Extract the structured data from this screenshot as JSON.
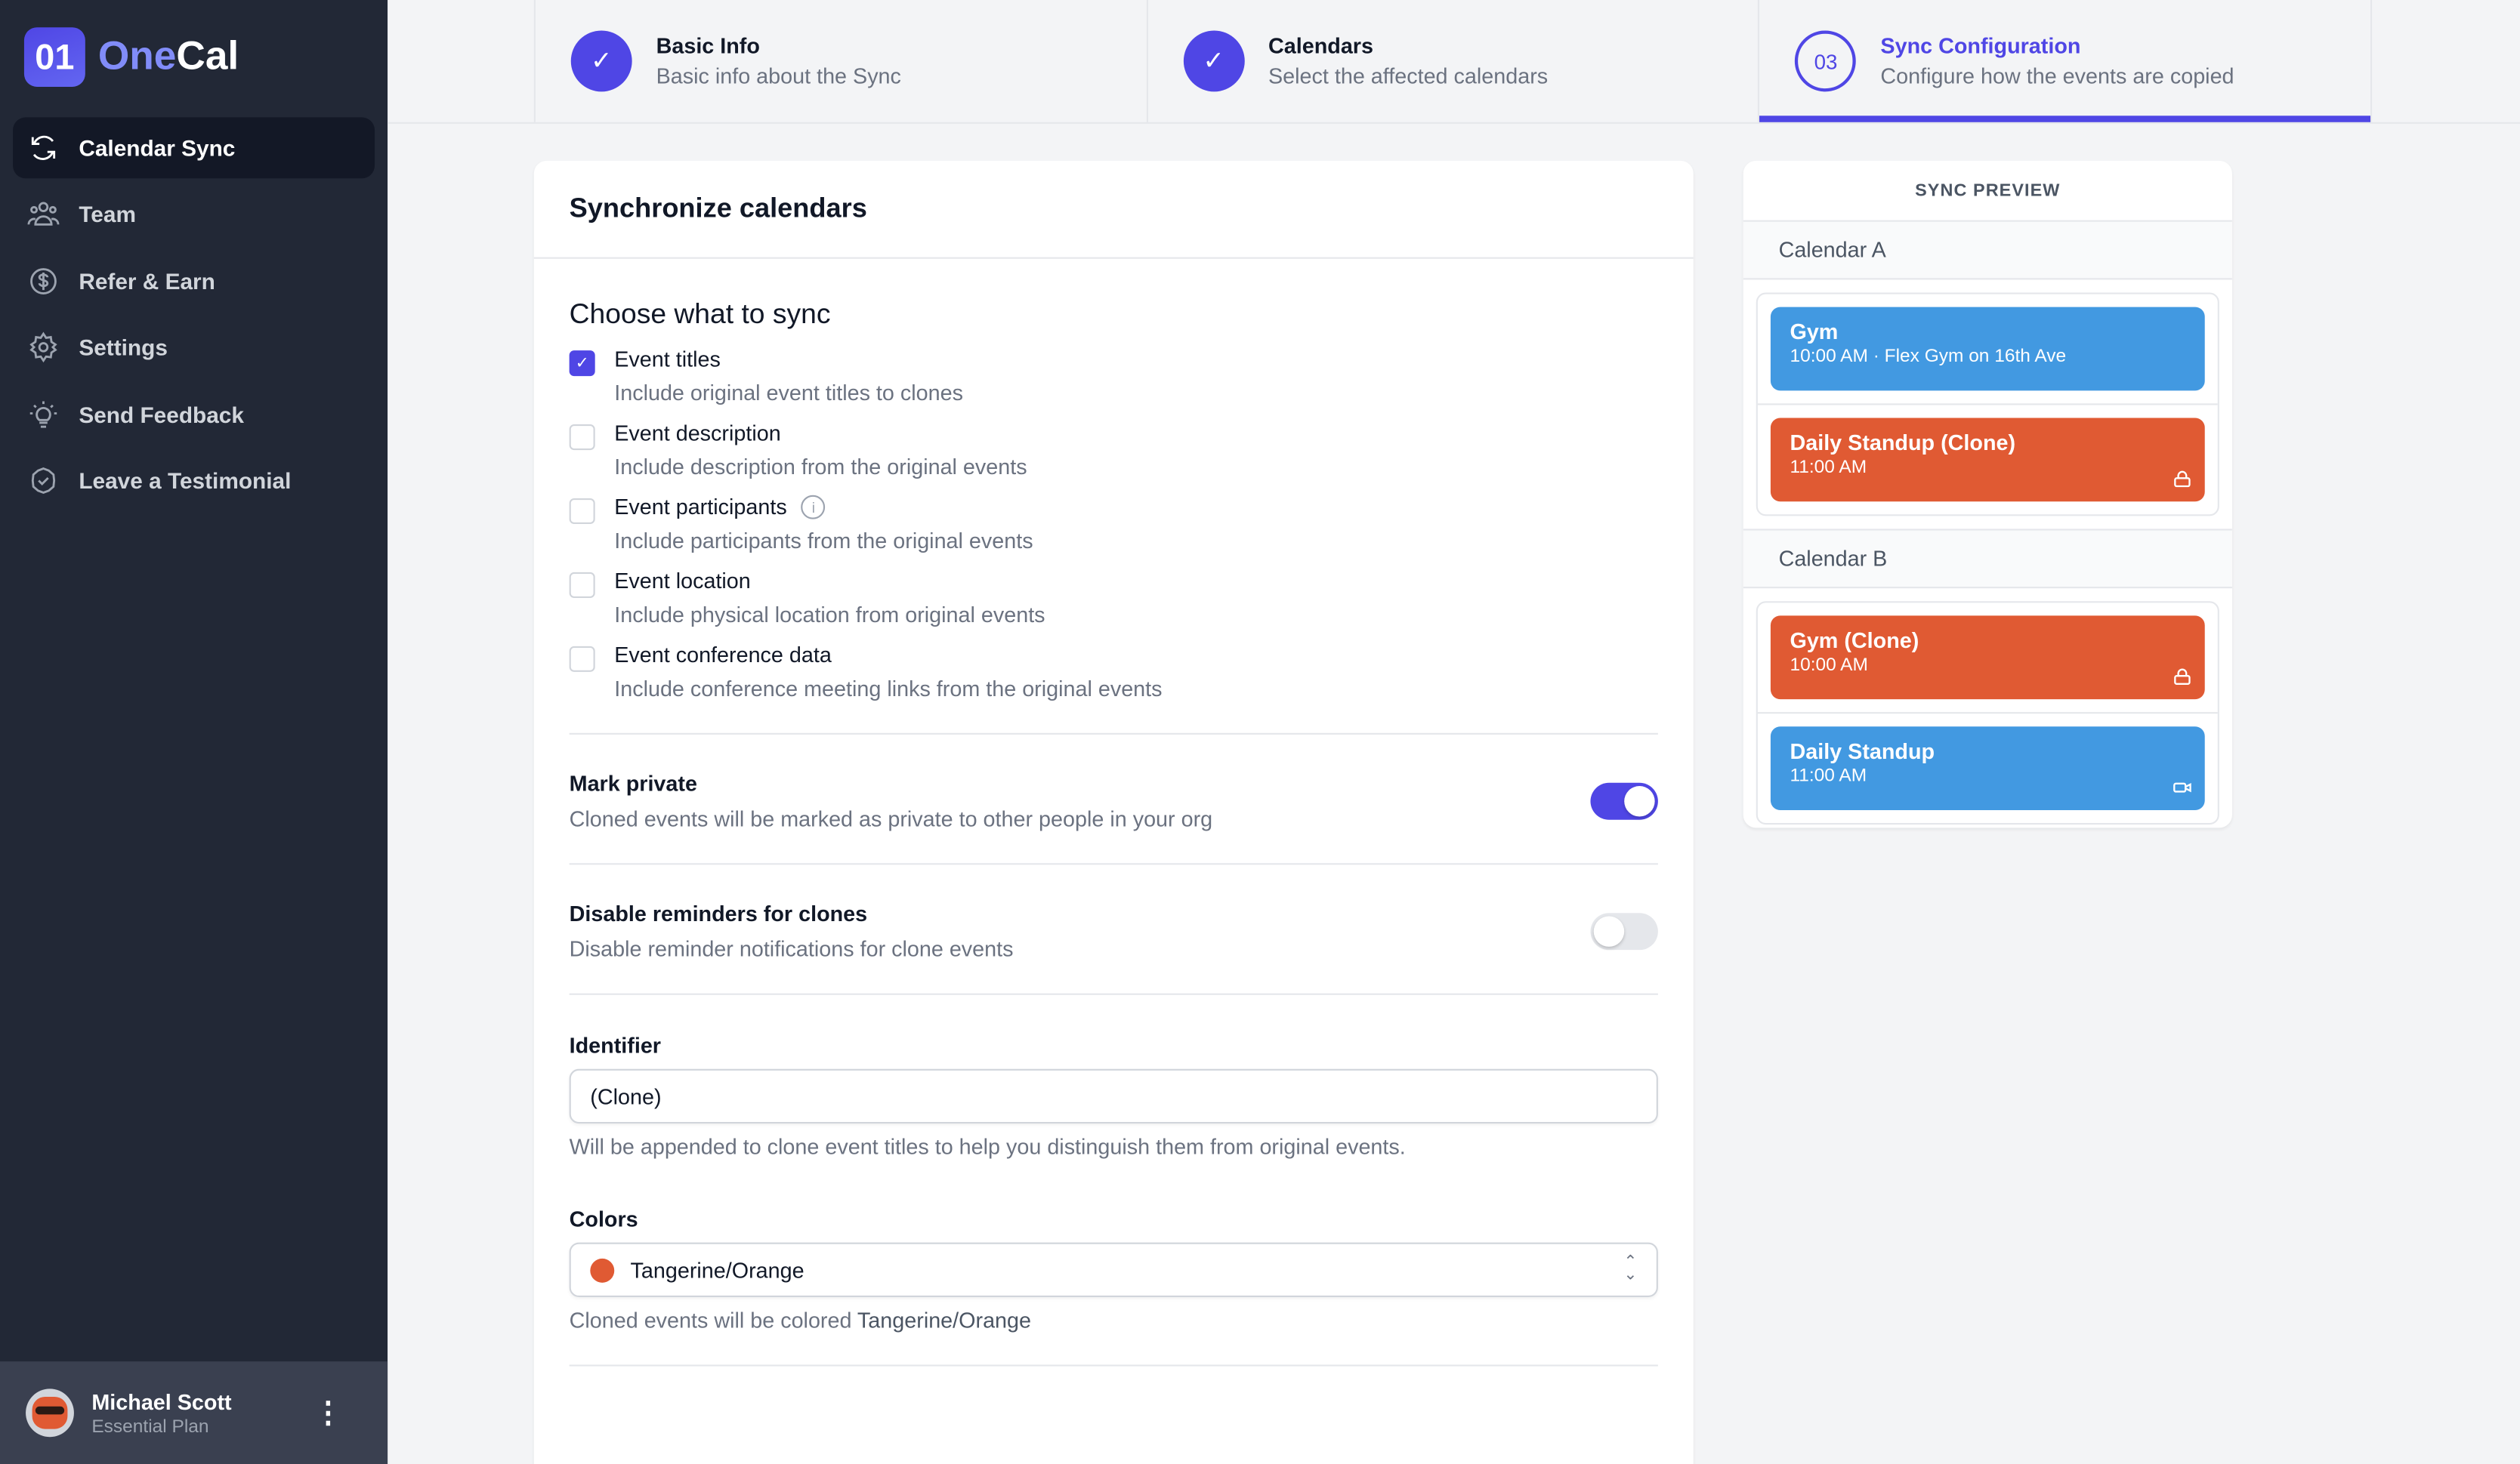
{
  "brand": {
    "logo_mark": "01",
    "name_part1": "One",
    "name_part2": "Cal"
  },
  "sidebar": {
    "items": [
      {
        "label": "Calendar Sync",
        "icon": "sync-icon",
        "active": true
      },
      {
        "label": "Team",
        "icon": "team-icon"
      },
      {
        "label": "Refer & Earn",
        "icon": "dollar-icon"
      },
      {
        "label": "Settings",
        "icon": "gear-icon"
      },
      {
        "label": "Send Feedback",
        "icon": "lightbulb-icon"
      },
      {
        "label": "Leave a Testimonial",
        "icon": "badge-check-icon"
      }
    ],
    "user": {
      "name": "Michael Scott",
      "plan": "Essential Plan"
    }
  },
  "stepper": {
    "steps": [
      {
        "title": "Basic Info",
        "subtitle": "Basic info about the Sync",
        "status": "complete"
      },
      {
        "title": "Calendars",
        "subtitle": "Select the affected calendars",
        "status": "complete"
      },
      {
        "title": "Sync Configuration",
        "subtitle": "Configure how the events are copied",
        "status": "current",
        "number": "03"
      }
    ]
  },
  "form": {
    "title": "Synchronize calendars",
    "section_title": "Choose what to sync",
    "options": [
      {
        "label": "Event titles",
        "description": "Include original event titles to clones",
        "checked": true
      },
      {
        "label": "Event description",
        "description": "Include description from the original events",
        "checked": false
      },
      {
        "label": "Event participants",
        "description": "Include participants from the original events",
        "checked": false
      },
      {
        "label": "Event location",
        "description": "Include physical location from original events",
        "checked": false
      },
      {
        "label": "Event conference data",
        "description": "Include conference meeting links from the original events",
        "checked": false
      }
    ],
    "mark_private": {
      "title": "Mark private",
      "description": "Cloned events will be marked as private to other people in your org",
      "on": true
    },
    "disable_reminders": {
      "title": "Disable reminders for clones",
      "description": "Disable reminder notifications for clone events",
      "on": false
    },
    "identifier": {
      "label": "Identifier",
      "value": "(Clone)",
      "help": "Will be appended to clone event titles to help you distinguish them from original events."
    },
    "colors": {
      "label": "Colors",
      "value": "Tangerine/Orange",
      "swatch": "#e05a33",
      "help_prefix": "Cloned events will be colored ",
      "help_value": "Tangerine/Orange"
    }
  },
  "preview": {
    "title": "SYNC PREVIEW",
    "calendars": [
      {
        "name": "Calendar A",
        "events": [
          {
            "title": "Gym",
            "subtitle": "10:00 AM · Flex Gym on 16th Ave",
            "color": "#4299e1",
            "icon": ""
          },
          {
            "title": "Daily Standup (Clone)",
            "subtitle": "11:00 AM",
            "color": "#e05a33",
            "icon": "lock-icon"
          }
        ]
      },
      {
        "name": "Calendar B",
        "events": [
          {
            "title": "Gym (Clone)",
            "subtitle": "10:00 AM",
            "color": "#e05a33",
            "icon": "lock-icon"
          },
          {
            "title": "Daily Standup",
            "subtitle": "11:00 AM",
            "color": "#4299e1",
            "icon": "video-icon"
          }
        ]
      }
    ]
  },
  "colors": {
    "accent": "#4f46e5",
    "sidebar_bg": "#222836"
  }
}
